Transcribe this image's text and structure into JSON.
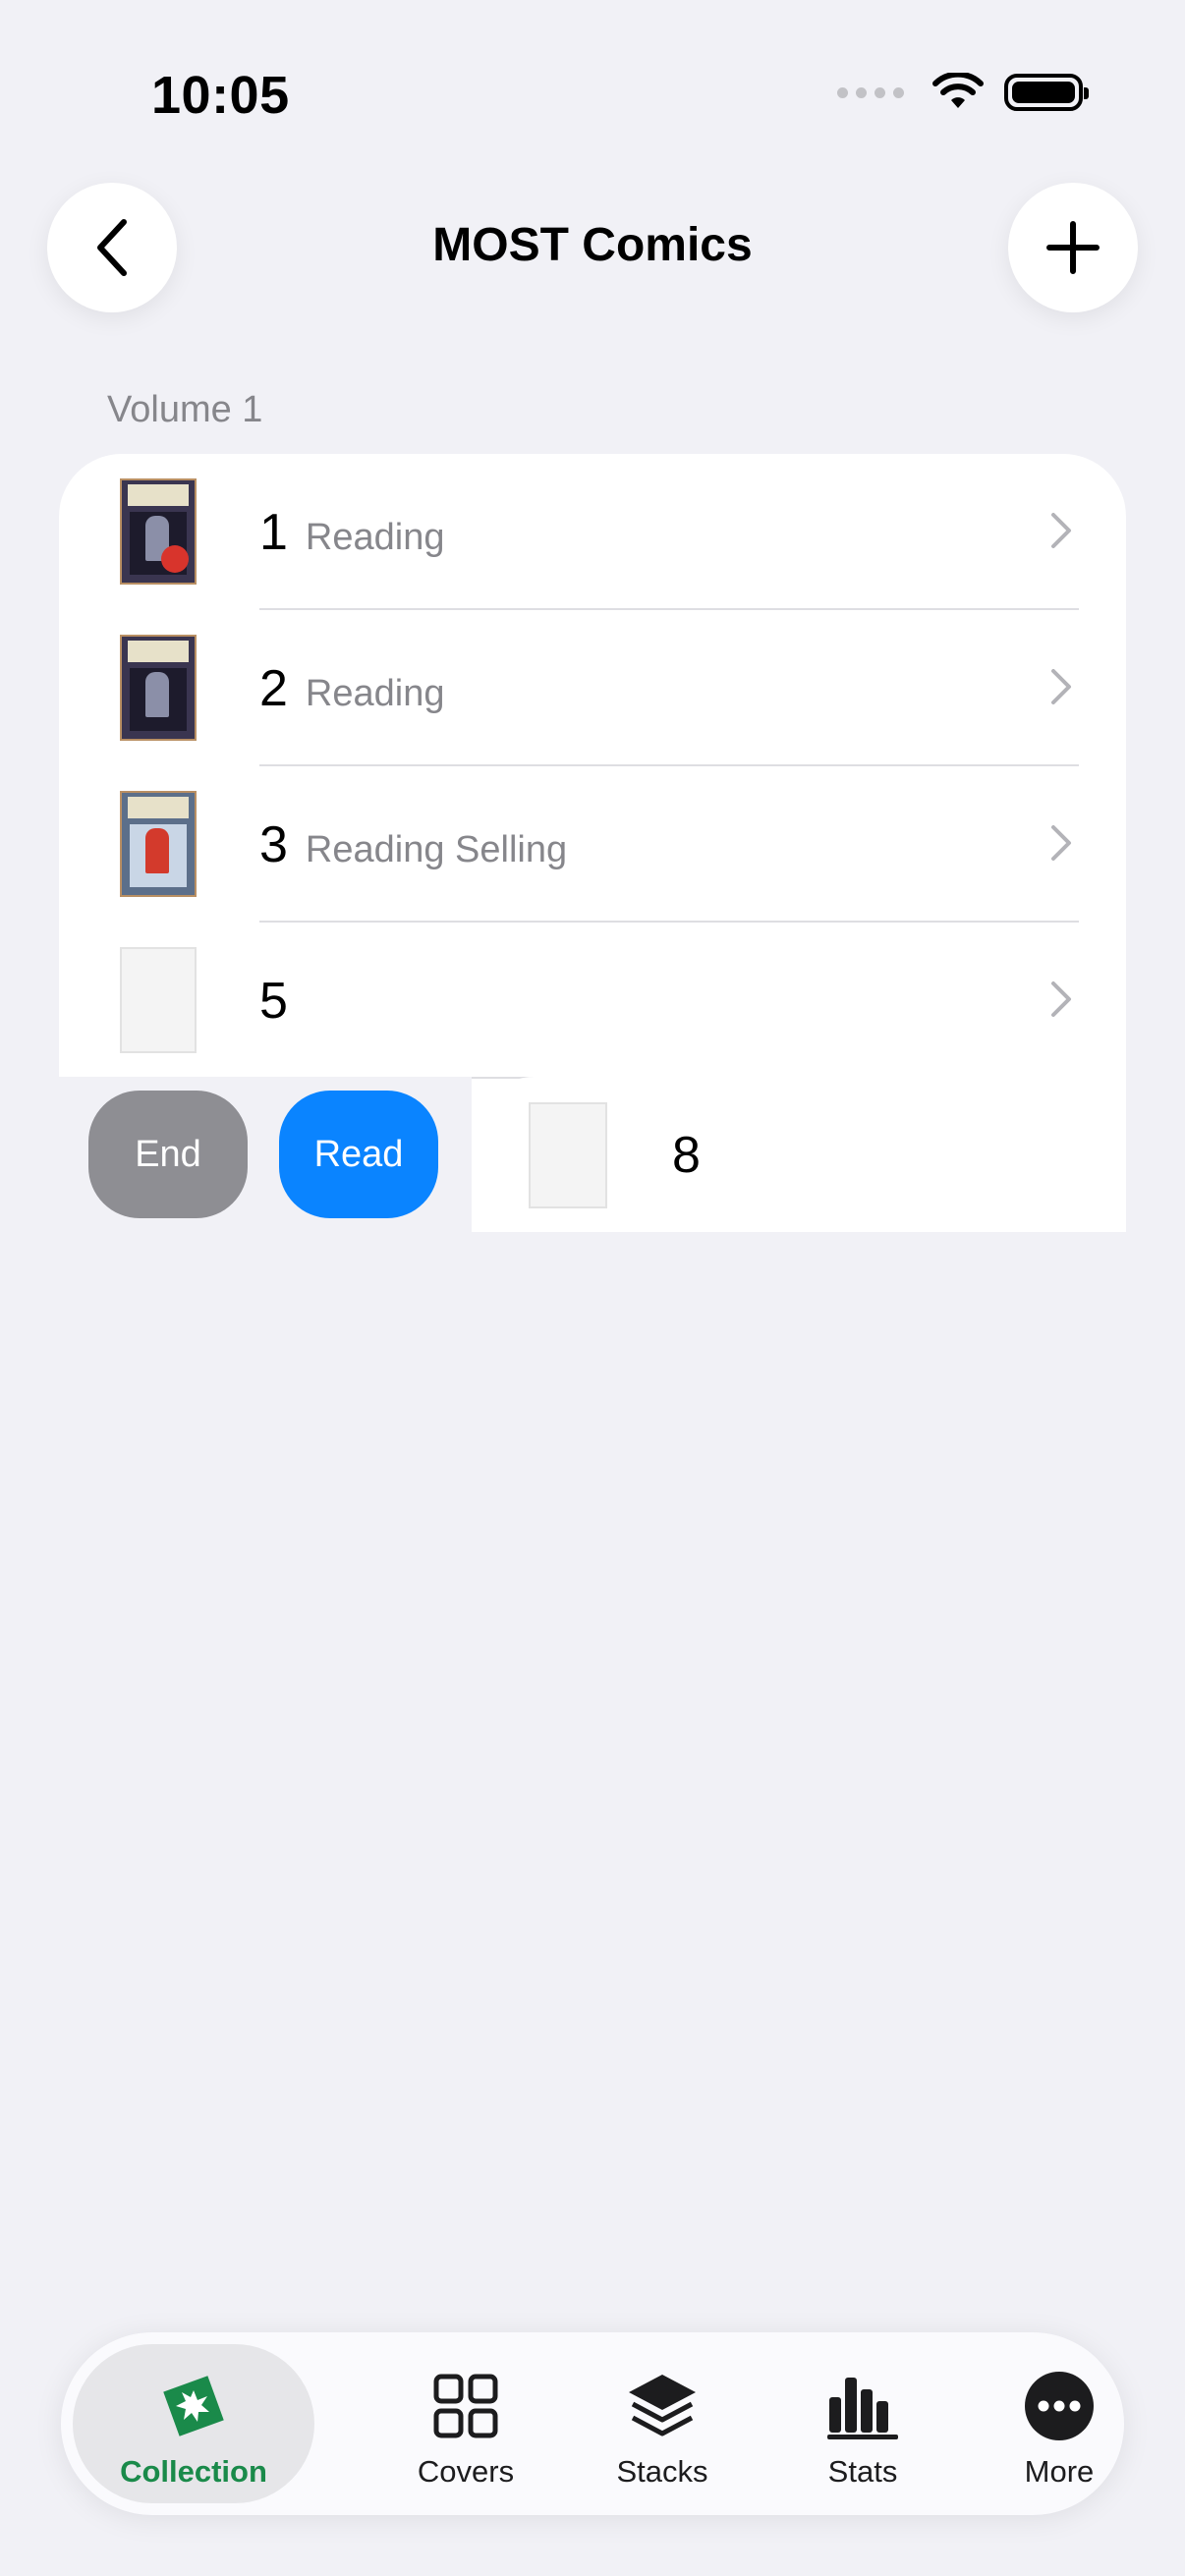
{
  "status_bar": {
    "time": "10:05"
  },
  "nav": {
    "title": "MOST Comics"
  },
  "section": {
    "header": "Volume 1"
  },
  "rows": [
    {
      "number": "1",
      "status": "Reading"
    },
    {
      "number": "2",
      "status": "Reading"
    },
    {
      "number": "3",
      "status": "Reading Selling"
    },
    {
      "number": "5",
      "status": ""
    }
  ],
  "swiped_row": {
    "number": "8",
    "actions": {
      "end_label": "End",
      "read_label": "Read"
    }
  },
  "colors": {
    "accent_blue": "#0a84ff",
    "end_gray": "#8e8e93",
    "active_tab_green": "#1a8a4a"
  },
  "tab_bar": {
    "tabs": [
      {
        "label": "Collection",
        "icon": "collection-icon",
        "active": true
      },
      {
        "label": "Covers",
        "icon": "grid-icon",
        "active": false
      },
      {
        "label": "Stacks",
        "icon": "stacks-icon",
        "active": false
      },
      {
        "label": "Stats",
        "icon": "bar-chart-icon",
        "active": false
      },
      {
        "label": "More",
        "icon": "more-icon",
        "active": false
      }
    ]
  }
}
